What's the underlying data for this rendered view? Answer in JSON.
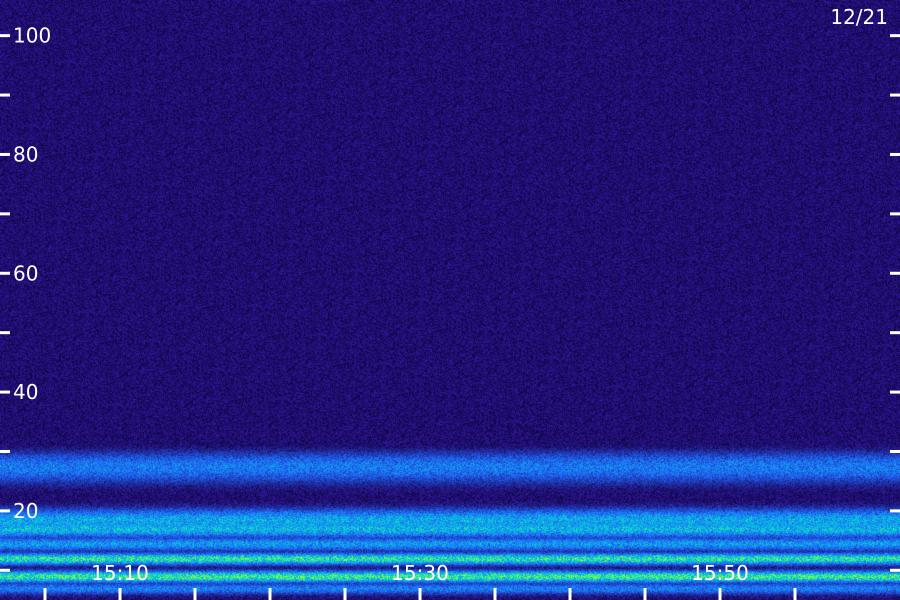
{
  "chart_data": {
    "type": "heatmap",
    "title": "",
    "date_label": "12/21",
    "xlabel": "",
    "ylabel": "",
    "y_ticks": [
      {
        "value": 100,
        "label": "100"
      },
      {
        "value": 90,
        "label": ""
      },
      {
        "value": 80,
        "label": "80"
      },
      {
        "value": 70,
        "label": ""
      },
      {
        "value": 60,
        "label": "60"
      },
      {
        "value": 50,
        "label": ""
      },
      {
        "value": 40,
        "label": "40"
      },
      {
        "value": 30,
        "label": ""
      },
      {
        "value": 20,
        "label": "20"
      },
      {
        "value": 10,
        "label": ""
      }
    ],
    "x_ticks": [
      {
        "value": "15:05",
        "label": ""
      },
      {
        "value": "15:10",
        "label": "15:10"
      },
      {
        "value": "15:15",
        "label": ""
      },
      {
        "value": "15:20",
        "label": ""
      },
      {
        "value": "15:25",
        "label": ""
      },
      {
        "value": "15:30",
        "label": "15:30"
      },
      {
        "value": "15:35",
        "label": ""
      },
      {
        "value": "15:40",
        "label": ""
      },
      {
        "value": "15:45",
        "label": ""
      },
      {
        "value": "15:50",
        "label": "15:50"
      },
      {
        "value": "15:55",
        "label": ""
      }
    ],
    "x_range": [
      "15:02",
      "15:62"
    ],
    "y_range": [
      5,
      106
    ],
    "colors": {
      "background": "#1a0a6e",
      "noise_low": "#0a0440",
      "noise_high": "#3a1aa8",
      "band": "#1e6cff",
      "band_bright": "#00e0d0",
      "band_peak": "#7dff3a",
      "axis": "#ffffff"
    },
    "bands": [
      {
        "freq": 27.5,
        "intensity": 0.55,
        "width": 3.0
      },
      {
        "freq": 18.5,
        "intensity": 0.65,
        "width": 2.0
      },
      {
        "freq": 17.0,
        "intensity": 0.7,
        "width": 1.5
      },
      {
        "freq": 14.5,
        "intensity": 0.6,
        "width": 1.2
      },
      {
        "freq": 12.0,
        "intensity": 0.9,
        "width": 1.0
      },
      {
        "freq": 9.0,
        "intensity": 0.95,
        "width": 1.0
      },
      {
        "freq": 7.0,
        "intensity": 0.5,
        "width": 1.0
      }
    ]
  }
}
